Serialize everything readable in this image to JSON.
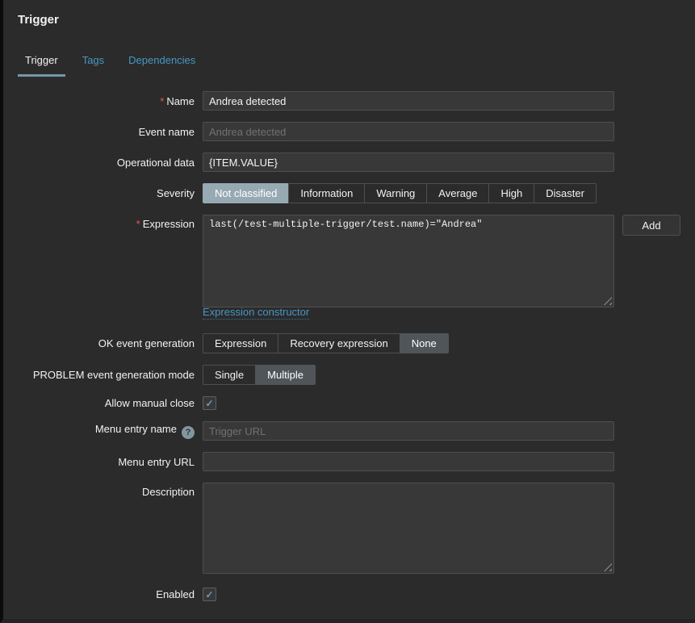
{
  "panel": {
    "title": "Trigger"
  },
  "tabs": [
    {
      "label": "Trigger",
      "active": true
    },
    {
      "label": "Tags",
      "active": false
    },
    {
      "label": "Dependencies",
      "active": false
    }
  ],
  "required_marker": "*",
  "icons": {
    "check": "✓",
    "help": "?"
  },
  "form": {
    "name": {
      "label": "Name",
      "value": "Andrea detected"
    },
    "event_name": {
      "label": "Event name",
      "placeholder": "Andrea detected"
    },
    "operational_data": {
      "label": "Operational data",
      "value": "{ITEM.VALUE}"
    },
    "severity": {
      "label": "Severity",
      "options": [
        "Not classified",
        "Information",
        "Warning",
        "Average",
        "High",
        "Disaster"
      ],
      "selected": "Not classified"
    },
    "expression": {
      "label": "Expression",
      "value": "last(/test-multiple-trigger/test.name)=\"Andrea\"",
      "add_button": "Add",
      "constructor_link": "Expression constructor"
    },
    "ok_event_generation": {
      "label": "OK event generation",
      "options": [
        "Expression",
        "Recovery expression",
        "None"
      ],
      "selected": "None"
    },
    "problem_event_generation_mode": {
      "label": "PROBLEM event generation mode",
      "options": [
        "Single",
        "Multiple"
      ],
      "selected": "Multiple"
    },
    "allow_manual_close": {
      "label": "Allow manual close",
      "checked": true
    },
    "menu_entry_name": {
      "label": "Menu entry name",
      "placeholder": "Trigger URL"
    },
    "menu_entry_url": {
      "label": "Menu entry URL",
      "value": ""
    },
    "description": {
      "label": "Description",
      "value": ""
    },
    "enabled": {
      "label": "Enabled",
      "checked": true
    }
  },
  "colors": {
    "accent_link": "#4796C4",
    "severity_selected": "#97AAB3",
    "segment_selected_gray": "#50555A",
    "required_red": "#E45959",
    "checkmark": "#7499AE",
    "tab_underline": "#7398A8"
  }
}
